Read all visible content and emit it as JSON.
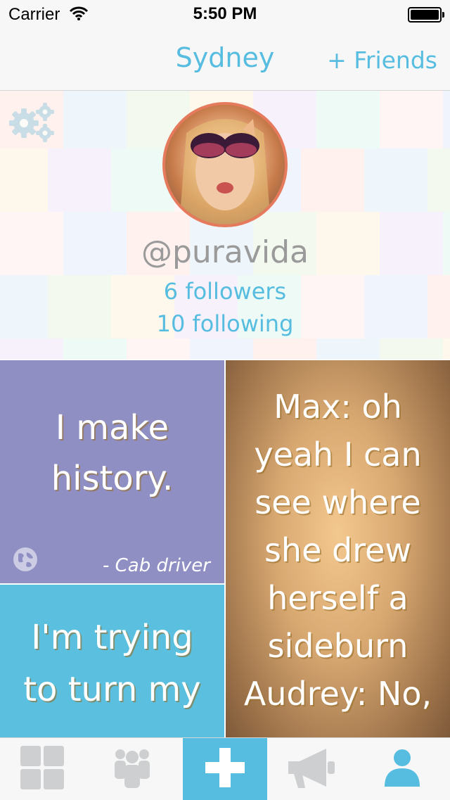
{
  "status_bar": {
    "carrier": "Carrier",
    "time": "5:50 PM",
    "wifi_icon": "wifi-icon",
    "battery_icon": "battery-icon"
  },
  "nav": {
    "title": "Sydney",
    "friends_button": "+ Friends"
  },
  "profile": {
    "settings_icon": "gears-icon",
    "username": "@puravida",
    "followers": "6 followers",
    "following": "10 following"
  },
  "cards": [
    {
      "quote": "I make history.",
      "author": "- Cab driver",
      "icon": "globe-icon",
      "color": "#8f8fc4"
    },
    {
      "quote": "I'm trying to turn my",
      "color": "#5bc0df"
    },
    {
      "quote": "Max: oh yeah I can see where she drew herself a sideburn Audrey: No,",
      "color": "#d8a871"
    }
  ],
  "tabs": [
    {
      "icon": "grid-icon"
    },
    {
      "icon": "group-icon"
    },
    {
      "icon": "plus-icon",
      "active": true
    },
    {
      "icon": "megaphone-icon"
    },
    {
      "icon": "profile-icon"
    }
  ],
  "colors": {
    "accent": "#56bde0",
    "tab_inactive": "#cdcfd1"
  }
}
